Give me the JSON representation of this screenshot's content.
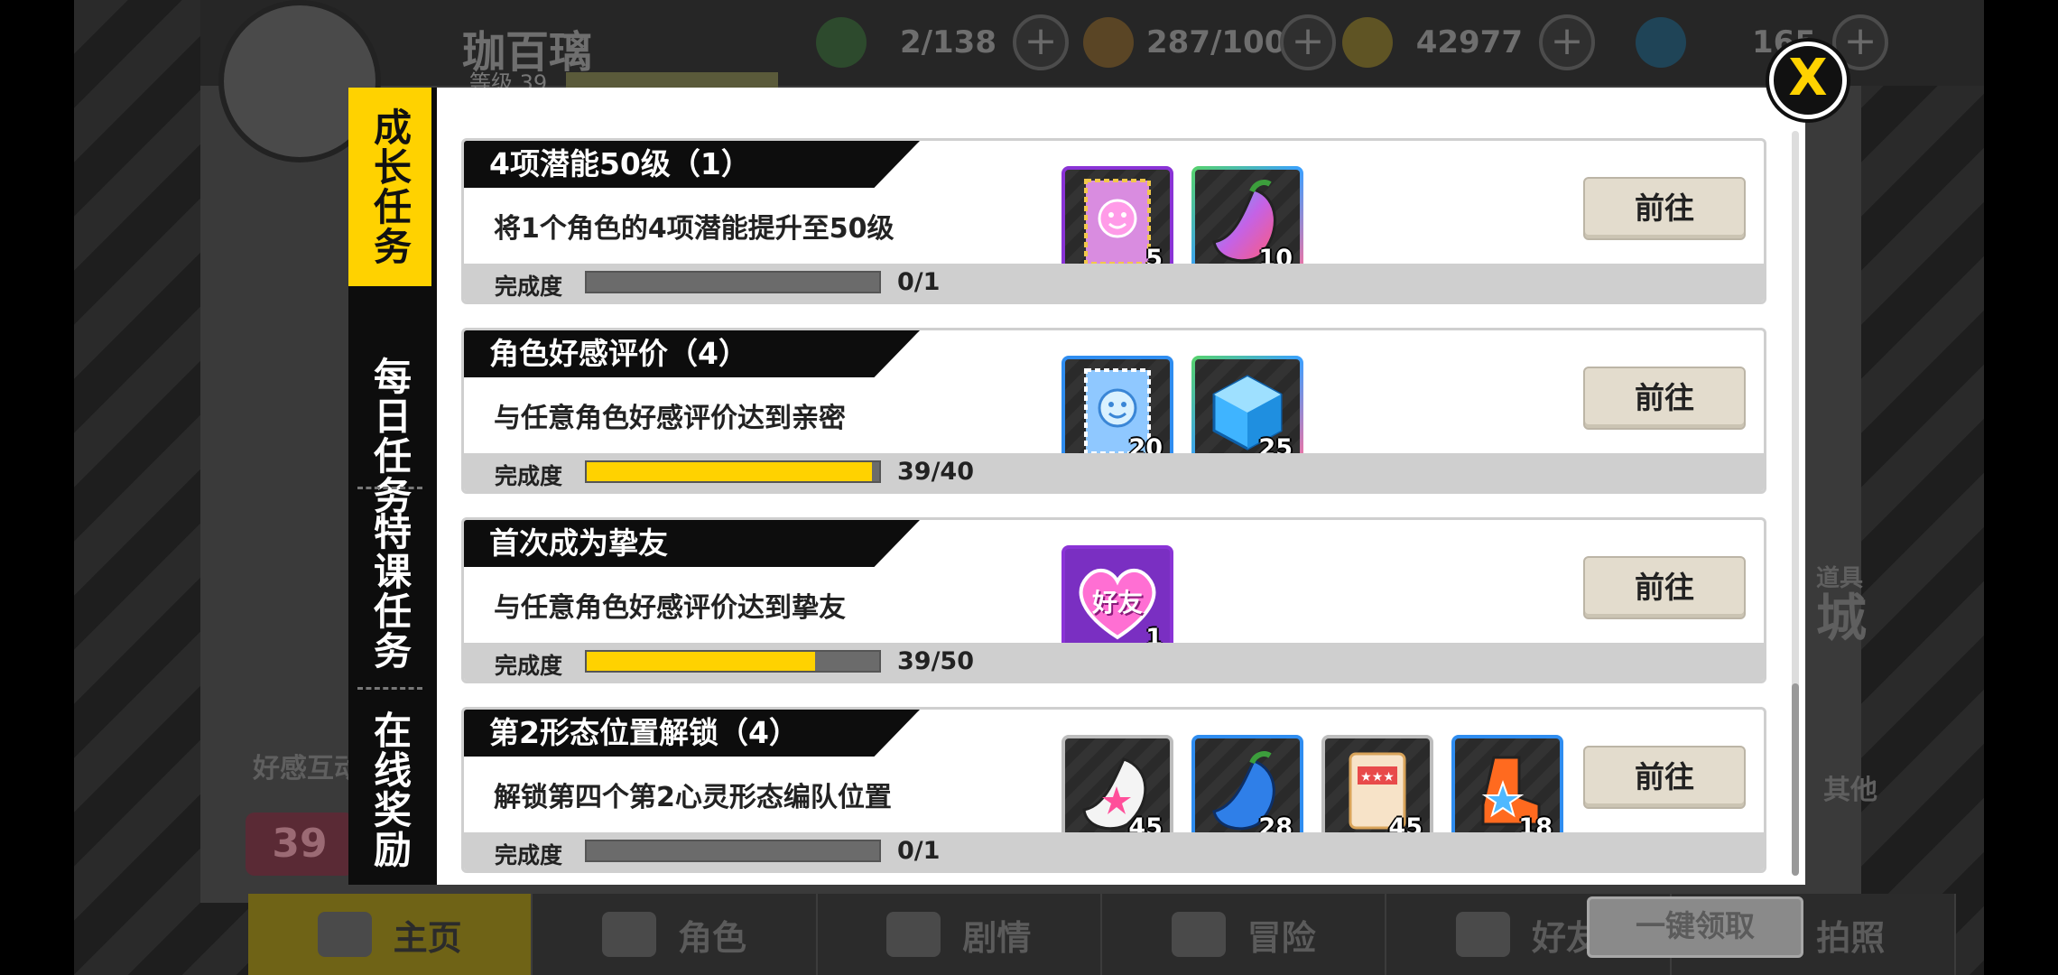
{
  "background": {
    "player_name": "珈百璃",
    "player_level_label": "等级 39",
    "resources": [
      {
        "icon": "stamina-leaf-icon",
        "value": "2/138",
        "color": "#3aa03a"
      },
      {
        "icon": "energy-drink-icon",
        "value": "287/100",
        "color": "#d98b2b"
      },
      {
        "icon": "gold-coin-icon",
        "value": "42977",
        "color": "#e3b52a"
      },
      {
        "icon": "blue-cube-gem-icon",
        "value": "165",
        "color": "#3a9be0"
      }
    ],
    "nav": [
      {
        "label": "主页",
        "icon": "home-icon",
        "active": true
      },
      {
        "label": "角色",
        "icon": "characters-icon"
      },
      {
        "label": "剧情",
        "icon": "story-cards-icon"
      },
      {
        "label": "冒险",
        "icon": "map-pin-icon"
      },
      {
        "label": "好友",
        "icon": "chat-bubbles-icon"
      },
      {
        "label": "拍照",
        "icon": "camera-icon"
      }
    ],
    "side_labels": {
      "affection": "好感互动",
      "shop": "城",
      "shop_sub": "道具",
      "other": "其他",
      "affection_level": "39"
    }
  },
  "tabs": [
    {
      "label": "成长任务",
      "active": true
    },
    {
      "label": "每日任务",
      "active": false
    },
    {
      "label": "特课任务",
      "active": false
    },
    {
      "label": "在线奖励",
      "active": false
    }
  ],
  "progress_label": "完成度",
  "go_label": "前往",
  "claim_all_label": "一键领取",
  "close_label": "X",
  "tasks": [
    {
      "title": "4项潜能50级（1）",
      "desc": "将1个角色的4项潜能提升至50级",
      "progress": "0/1",
      "fraction": 0,
      "rewards": [
        {
          "icon": "purple-stamp-ticket-icon",
          "rarity": "purple",
          "qty": "5"
        },
        {
          "icon": "rainbow-pepper-icon",
          "rarity": "rainbow",
          "qty": "10"
        }
      ]
    },
    {
      "title": "角色好感评价（4）",
      "desc": "与任意角色好感评价达到亲密",
      "progress": "39/40",
      "fraction": 0.975,
      "rewards": [
        {
          "icon": "blue-stamp-ticket-icon",
          "rarity": "blue",
          "qty": "20"
        },
        {
          "icon": "blue-cube-gem-icon",
          "rarity": "rainbow",
          "qty": "25"
        }
      ]
    },
    {
      "title": "首次成为挚友",
      "desc": "与任意角色好感评价达到挚友",
      "progress": "39/50",
      "fraction": 0.78,
      "rewards": [
        {
          "icon": "friend-heart-badge-icon",
          "rarity": "purple",
          "qty": "1",
          "badge_text": "好友"
        }
      ]
    },
    {
      "title": "第2形态位置解锁（4）",
      "desc": "解锁第四个第2心灵形态编队位置",
      "progress": "0/1",
      "fraction": 0,
      "rewards": [
        {
          "icon": "white-star-pepper-icon",
          "rarity": "grey",
          "qty": "45"
        },
        {
          "icon": "blue-pepper-icon",
          "rarity": "blue",
          "qty": "28"
        },
        {
          "icon": "snack-bag-icon",
          "rarity": "grey",
          "qty": "45"
        },
        {
          "icon": "orange-star-boot-icon",
          "rarity": "blue",
          "qty": "18"
        }
      ]
    }
  ]
}
